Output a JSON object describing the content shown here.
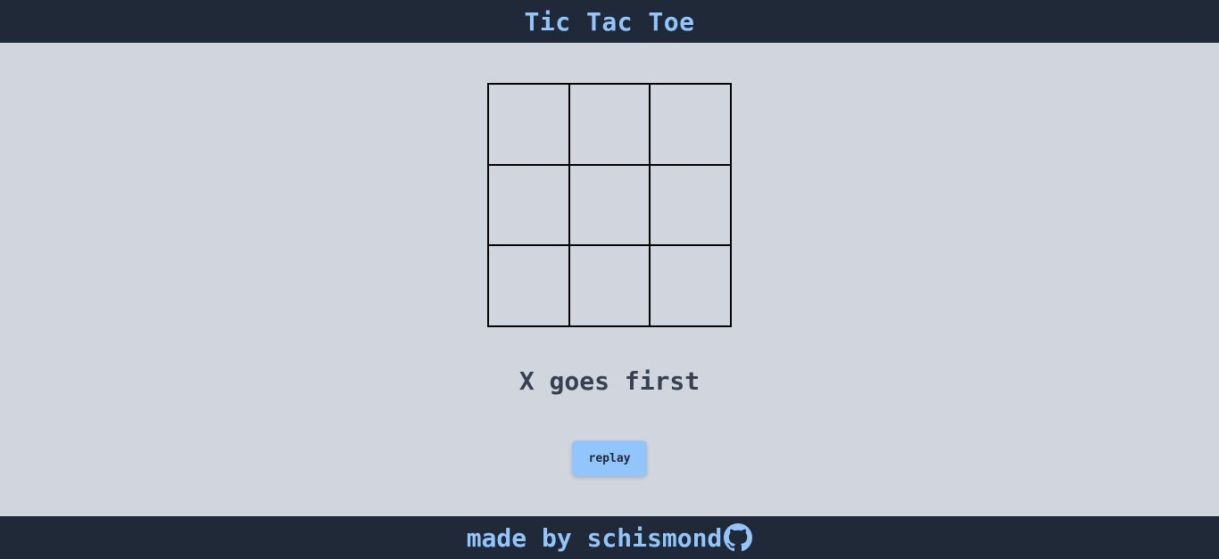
{
  "header": {
    "title": "Tic Tac Toe"
  },
  "board": {
    "cells": [
      "",
      "",
      "",
      "",
      "",
      "",
      "",
      "",
      ""
    ]
  },
  "status": {
    "message": "X goes first"
  },
  "controls": {
    "replay_label": "replay"
  },
  "footer": {
    "credit": "made by schismond",
    "icon": "github-icon"
  },
  "colors": {
    "header_bg": "#1f2937",
    "accent": "#93c5fd",
    "page_bg": "#d1d5dd",
    "text": "#374151"
  }
}
